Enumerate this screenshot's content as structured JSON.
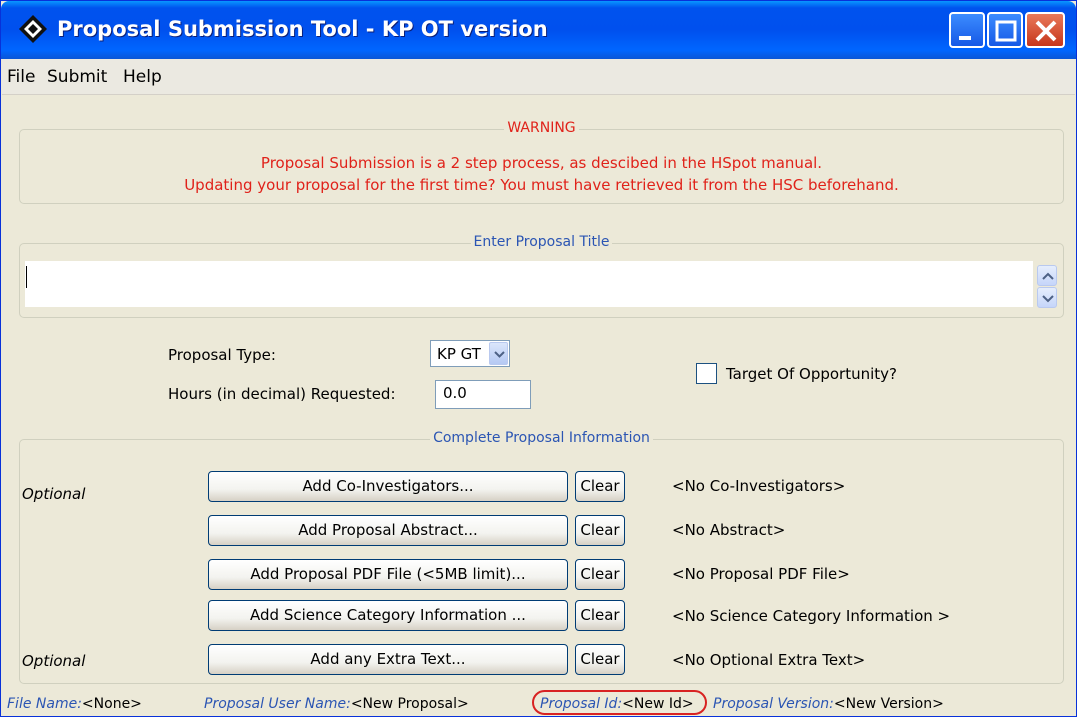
{
  "window": {
    "title": "Proposal Submission Tool - KP OT version"
  },
  "menu": [
    "File",
    "Submit",
    "Help"
  ],
  "warning": {
    "heading": "WARNING",
    "line1": "Proposal Submission is a 2 step process, as descibed in the HSpot manual.",
    "line2": "Updating your proposal for the first time? You must have retrieved it from the HSC beforehand."
  },
  "proposal_title": {
    "legend": "Enter Proposal Title",
    "value": ""
  },
  "proposal_type": {
    "label": "Proposal Type:",
    "selected": "KP GT"
  },
  "hours": {
    "label": "Hours (in decimal) Requested:",
    "value": "0.0"
  },
  "target_of_opportunity": {
    "label": "Target Of Opportunity?",
    "checked": false
  },
  "info": {
    "legend": "Complete Proposal Information",
    "clear_label": "Clear",
    "rows": [
      {
        "optional": "Optional",
        "button": "Add Co-Investigators...",
        "status": "<No Co-Investigators>"
      },
      {
        "optional": "",
        "button": "Add Proposal Abstract...",
        "status": "<No Abstract>"
      },
      {
        "optional": "",
        "button": "Add Proposal PDF File (<5MB limit)...",
        "status": "<No Proposal PDF File>"
      },
      {
        "optional": "",
        "button": "Add Science Category Information ...",
        "status": "<No Science Category Information >"
      },
      {
        "optional": "Optional",
        "button": "Add any Extra Text...",
        "status": "<No Optional Extra Text>"
      }
    ]
  },
  "status_bar": {
    "file_name_key": "File Name:",
    "file_name_val": "<None>",
    "user_key": "Proposal User Name:",
    "user_val": "<New Proposal>",
    "id_key": "Proposal Id:",
    "id_val": "<New Id>",
    "version_key": "Proposal Version:",
    "version_val": "<New Version>"
  },
  "colors": {
    "warning": "#e0221a",
    "legend_blue": "#2b55b3",
    "annotation_circle": "#d82222",
    "titlebar": "#0053ee"
  },
  "icons": {
    "app": "diamond-app-icon",
    "minimize": "minimize-icon",
    "maximize": "maximize-icon",
    "close": "close-icon"
  }
}
